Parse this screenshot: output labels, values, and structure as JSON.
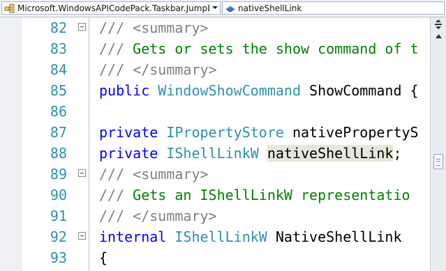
{
  "navbar": {
    "type_dropdown": {
      "icon": "class-icon",
      "text": "Microsoft.WindowsAPICodePack.Taskbar.JumpListLi"
    },
    "member_dropdown": {
      "icon": "field-icon",
      "text": "nativeShellLink"
    }
  },
  "colors": {
    "comment_gray": "#808080",
    "comment_green": "#008000",
    "keyword": "#0000ff",
    "type": "#2b91af",
    "line_number": "#2b91af",
    "highlight": "#e5e8d8"
  },
  "lines": [
    {
      "num": "82",
      "fold": true,
      "tokens": [
        {
          "c": "cm",
          "t": "/// <summary>"
        }
      ]
    },
    {
      "num": "83",
      "fold": false,
      "tokens": [
        {
          "c": "cm",
          "t": "/// "
        },
        {
          "c": "cg",
          "t": "Gets or sets the show command of t"
        }
      ]
    },
    {
      "num": "84",
      "fold": false,
      "tokens": [
        {
          "c": "cm",
          "t": "/// </summary>"
        }
      ]
    },
    {
      "num": "85",
      "fold": false,
      "tokens": [
        {
          "c": "kw",
          "t": "public "
        },
        {
          "c": "ty",
          "t": "WindowShowCommand"
        },
        {
          "c": "",
          "t": " ShowCommand {"
        }
      ]
    },
    {
      "num": "86",
      "fold": false,
      "tokens": []
    },
    {
      "num": "87",
      "fold": false,
      "tokens": [
        {
          "c": "kw",
          "t": "private "
        },
        {
          "c": "ty",
          "t": "IPropertyStore"
        },
        {
          "c": "",
          "t": " nativePropertyS"
        }
      ]
    },
    {
      "num": "88",
      "fold": false,
      "tokens": [
        {
          "c": "kw",
          "t": "private "
        },
        {
          "c": "ty",
          "t": "IShellLinkW"
        },
        {
          "c": "",
          "t": " "
        },
        {
          "c": "hl",
          "t": "nativeShellLink"
        },
        {
          "c": "",
          "t": ";"
        }
      ]
    },
    {
      "num": "89",
      "fold": true,
      "tokens": [
        {
          "c": "cm",
          "t": "/// <summary>"
        }
      ]
    },
    {
      "num": "90",
      "fold": false,
      "tokens": [
        {
          "c": "cm",
          "t": "/// "
        },
        {
          "c": "cg",
          "t": "Gets an IShellLinkW representatio"
        }
      ]
    },
    {
      "num": "91",
      "fold": false,
      "tokens": [
        {
          "c": "cm",
          "t": "/// </summary>"
        }
      ]
    },
    {
      "num": "92",
      "fold": true,
      "tokens": [
        {
          "c": "kw",
          "t": "internal "
        },
        {
          "c": "ty",
          "t": "IShellLinkW"
        },
        {
          "c": "",
          "t": " NativeShellLink"
        }
      ]
    },
    {
      "num": "93",
      "fold": false,
      "tokens": [
        {
          "c": "",
          "t": "{"
        }
      ]
    }
  ]
}
